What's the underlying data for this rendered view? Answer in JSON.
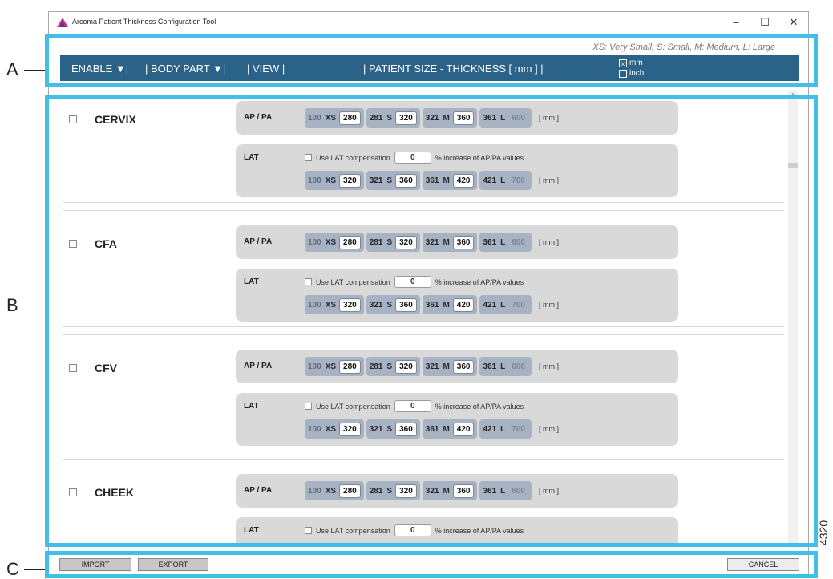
{
  "window": {
    "title": "Arcoma Patient Thickness Configuration Tool",
    "controls": {
      "minimize": "–",
      "maximize": "☐",
      "close": "✕"
    },
    "accent_color": "#2a6288",
    "callout_color": "#42bfe8"
  },
  "callouts": {
    "a": "A",
    "b": "B",
    "c": "C",
    "figure_number": "4320"
  },
  "legend": "XS: Very Small, S: Small, M: Medium, L: Large",
  "header": {
    "enable": "ENABLE ▼|",
    "body_part": "| BODY PART ▼|",
    "view": "| VIEW |",
    "patient_size": "| PATIENT SIZE - THICKNESS [ mm ] |",
    "unit_mm": {
      "label": "mm",
      "checked": "x"
    },
    "unit_inch": {
      "label": "inch",
      "checked": ""
    }
  },
  "sections": [
    {
      "name": "CERVIX",
      "ap": {
        "label": "AP / PA",
        "ranges": [
          {
            "lo": "100",
            "code": "XS",
            "hi": "280"
          },
          {
            "lo": "281",
            "code": "S",
            "hi": "320"
          },
          {
            "lo": "321",
            "code": "M",
            "hi": "360"
          },
          {
            "lo": "361",
            "code": "L",
            "hi": "600"
          }
        ],
        "unit": "[ mm ]"
      },
      "lat": {
        "label": "LAT",
        "comp_label": "Use LAT compensation",
        "comp_value": "0",
        "comp_suffix": "% increase of AP/PA values",
        "ranges": [
          {
            "lo": "100",
            "code": "XS",
            "hi": "320"
          },
          {
            "lo": "321",
            "code": "S",
            "hi": "360"
          },
          {
            "lo": "361",
            "code": "M",
            "hi": "420"
          },
          {
            "lo": "421",
            "code": "L",
            "hi": "700"
          }
        ],
        "unit": "[ mm ]"
      }
    },
    {
      "name": "CFA",
      "ap": {
        "label": "AP / PA",
        "ranges": [
          {
            "lo": "100",
            "code": "XS",
            "hi": "280"
          },
          {
            "lo": "281",
            "code": "S",
            "hi": "320"
          },
          {
            "lo": "321",
            "code": "M",
            "hi": "360"
          },
          {
            "lo": "361",
            "code": "L",
            "hi": "600"
          }
        ],
        "unit": "[ mm ]"
      },
      "lat": {
        "label": "LAT",
        "comp_label": "Use LAT compensation",
        "comp_value": "0",
        "comp_suffix": "% increase of AP/PA values",
        "ranges": [
          {
            "lo": "100",
            "code": "XS",
            "hi": "320"
          },
          {
            "lo": "321",
            "code": "S",
            "hi": "360"
          },
          {
            "lo": "361",
            "code": "M",
            "hi": "420"
          },
          {
            "lo": "421",
            "code": "L",
            "hi": "700"
          }
        ],
        "unit": "[ mm ]"
      }
    },
    {
      "name": "CFV",
      "ap": {
        "label": "AP / PA",
        "ranges": [
          {
            "lo": "100",
            "code": "XS",
            "hi": "280"
          },
          {
            "lo": "281",
            "code": "S",
            "hi": "320"
          },
          {
            "lo": "321",
            "code": "M",
            "hi": "360"
          },
          {
            "lo": "361",
            "code": "L",
            "hi": "600"
          }
        ],
        "unit": "[ mm ]"
      },
      "lat": {
        "label": "LAT",
        "comp_label": "Use LAT compensation",
        "comp_value": "0",
        "comp_suffix": "% increase of AP/PA values",
        "ranges": [
          {
            "lo": "100",
            "code": "XS",
            "hi": "320"
          },
          {
            "lo": "321",
            "code": "S",
            "hi": "360"
          },
          {
            "lo": "361",
            "code": "M",
            "hi": "420"
          },
          {
            "lo": "421",
            "code": "L",
            "hi": "700"
          }
        ],
        "unit": "[ mm ]"
      }
    },
    {
      "name": "CHEEK",
      "ap": {
        "label": "AP / PA",
        "ranges": [
          {
            "lo": "100",
            "code": "XS",
            "hi": "280"
          },
          {
            "lo": "281",
            "code": "S",
            "hi": "320"
          },
          {
            "lo": "321",
            "code": "M",
            "hi": "360"
          },
          {
            "lo": "361",
            "code": "L",
            "hi": "600"
          }
        ],
        "unit": "[ mm ]"
      },
      "lat": {
        "label": "LAT",
        "comp_label": "Use LAT compensation",
        "comp_value": "0",
        "comp_suffix": "% increase of AP/PA values",
        "ranges": [],
        "unit": ""
      }
    }
  ],
  "footer": {
    "import": "IMPORT",
    "export": "EXPORT",
    "cancel": "CANCEL"
  }
}
